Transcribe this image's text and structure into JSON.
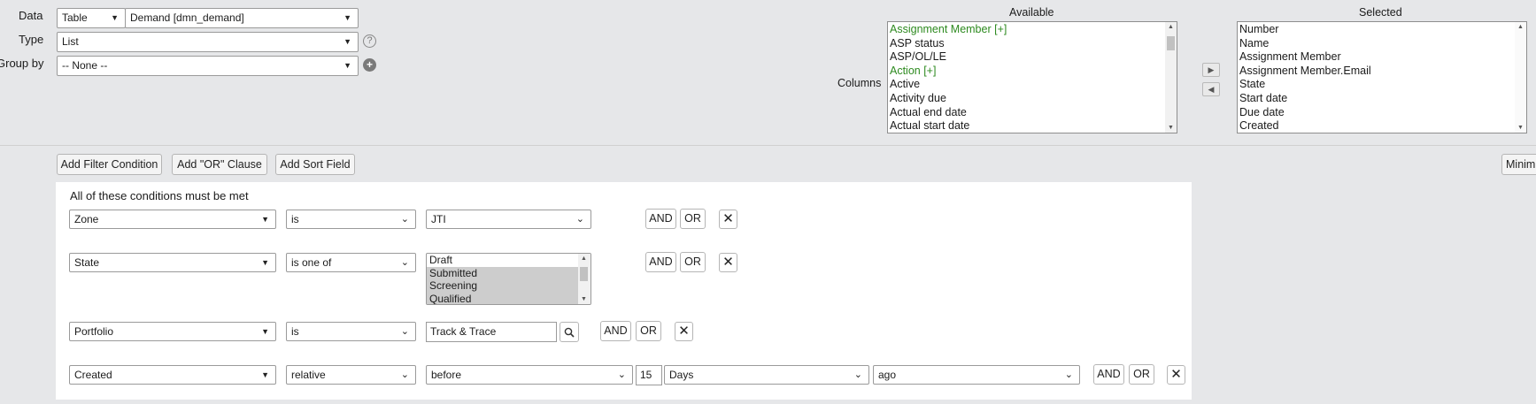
{
  "top": {
    "data_label": "Data",
    "data_source_value": "Table",
    "data_table_value": "Demand [dmn_demand]",
    "type_label": "Type",
    "type_value": "List",
    "groupby_label": "Group by",
    "groupby_value": "-- None --",
    "help_glyph": "?",
    "add_glyph": "+"
  },
  "columns": {
    "label": "Columns",
    "available_heading": "Available",
    "selected_heading": "Selected",
    "available": [
      {
        "label": "Assignment Member [+]",
        "color": "#2d8a1f"
      },
      {
        "label": "ASP status"
      },
      {
        "label": "ASP/OL/LE"
      },
      {
        "label": "Action [+]",
        "color": "#2d8a1f"
      },
      {
        "label": "Active"
      },
      {
        "label": "Activity due"
      },
      {
        "label": "Actual end date"
      },
      {
        "label": "Actual start date"
      }
    ],
    "selected": [
      {
        "label": "Number"
      },
      {
        "label": "Name"
      },
      {
        "label": "Assignment Member"
      },
      {
        "label": "Assignment Member.Email"
      },
      {
        "label": "State"
      },
      {
        "label": "Start date"
      },
      {
        "label": "Due date"
      },
      {
        "label": "Created"
      }
    ]
  },
  "toolbar": {
    "add_filter": "Add Filter Condition",
    "add_or": "Add \"OR\" Clause",
    "add_sort": "Add Sort Field",
    "minimize": "Minim"
  },
  "filter": {
    "heading": "All of these conditions must be met",
    "and_label": "AND",
    "or_label": "OR",
    "remove_glyph": "✕",
    "conditions": [
      {
        "field": "Zone",
        "operator": "is",
        "value": "JTI"
      },
      {
        "field": "State",
        "operator": "is one of",
        "options": [
          {
            "label": "Draft",
            "selected": false
          },
          {
            "label": "Submitted",
            "selected": true
          },
          {
            "label": "Screening",
            "selected": true
          },
          {
            "label": "Qualified",
            "selected": true
          }
        ]
      },
      {
        "field": "Portfolio",
        "operator": "is",
        "value": "Track & Trace"
      },
      {
        "field": "Created",
        "operator": "relative",
        "direction": "before",
        "quantity": "15",
        "unit": "Days",
        "suffix": "ago"
      }
    ]
  }
}
